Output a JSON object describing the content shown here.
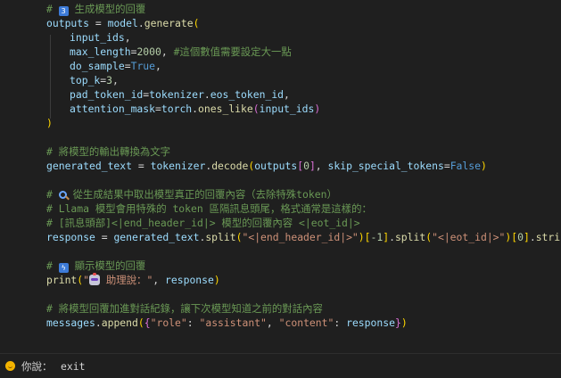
{
  "code": {
    "comment_generate": "生成模型的回覆",
    "outputs_var": "outputs",
    "assign": " = ",
    "model_obj": "model",
    "generate_fn": "generate",
    "arg_input_ids": "input_ids",
    "arg_max_length": "max_length",
    "max_length_value": "2000",
    "max_length_comment": "#這個數值需要設定大一點",
    "arg_do_sample": "do_sample",
    "do_sample_value": "True",
    "arg_top_k": "top_k",
    "top_k_value": "3",
    "arg_pad_token_id": "pad_token_id",
    "tokenizer_obj": "tokenizer",
    "eos_token_id": "eos_token_id",
    "arg_attention_mask": "attention_mask",
    "torch_obj": "torch",
    "ones_like_fn": "ones_like",
    "comment_decode": "# 將模型的輸出轉換為文字",
    "generated_text_var": "generated_text",
    "decode_fn": "decode",
    "zero_index": "0",
    "skip_special_tokens_arg": "skip_special_tokens",
    "false_value": "False",
    "comment_extract_suffix": "從生成結果中取出模型真正的回覆內容（去除特殊token）",
    "comment_llama": "# Llama 模型會用特殊的 token 區隔訊息頭尾，格式通常是這樣的：",
    "comment_format": "# [訊息頭部]<|end_header_id|> 模型的回覆內容 <|eot_id|>",
    "response_var": "response",
    "split_fn": "split",
    "end_header_string": "\"<|end_header_id|>\"",
    "minus_one": "-1",
    "eot_string": "\"<|eot_id|>\"",
    "strip_fn": "strip",
    "comment_display_suffix": "顯示模型的回覆",
    "print_fn": "print",
    "assistant_label_suffix": "助理說：\"",
    "comment_append": "# 將模型回覆加進對話紀錄，讓下次模型知道之前的對話內容",
    "messages_var": "messages",
    "append_fn": "append",
    "role_key": "\"role\"",
    "assistant_value": "\"assistant\"",
    "content_key": "\"content\""
  },
  "terminal": {
    "prompt_label": "你說：",
    "input_value": "exit"
  },
  "icons": {
    "keycap_three": "keycap-three-icon",
    "magnifier": "magnifier-icon",
    "lightning": "lightning-icon",
    "robot": "robot-icon",
    "smile": "smile-icon"
  }
}
